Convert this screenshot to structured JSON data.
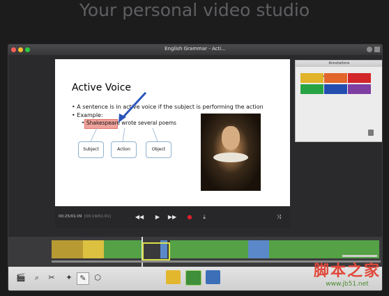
{
  "headline": "Your personal video studio",
  "window": {
    "title": "English Grammar - Acti...",
    "traffic_lights": {
      "close": "#fc5f57",
      "minimize": "#fdbc2e",
      "zoom": "#29c940"
    }
  },
  "slide": {
    "title": "Active Voice",
    "bullet1": "• A sentence is in active voice if the subject is performing the action",
    "bullet2": "• Example:",
    "sentence_subject": "Shakespeare",
    "sentence_rest": " wrote several poems",
    "sentence_bullet": "•",
    "boxes": [
      "Subject",
      "Action",
      "Object"
    ]
  },
  "controls": {
    "elapsed": "00:25/01:09",
    "selection": "[00:19/01:01]",
    "rewind": "◀◀",
    "play": "▶",
    "forward": "▶▶",
    "record": "●",
    "download": "⤓",
    "mute": "⤨"
  },
  "annotations": {
    "title": "Annotations",
    "tools": [
      "circle-icon",
      "line-icon",
      "rectangle-icon",
      "text-icon"
    ],
    "colors": [
      "#e0b32a",
      "#e2662c",
      "#d3262a",
      "#27a343",
      "#244db0",
      "#7f3ea1"
    ]
  },
  "timeline": {
    "segments": [
      {
        "color": "#b89a33"
      },
      {
        "color": "#dcc040"
      },
      {
        "color": "#55a146"
      },
      {
        "color": "#5b88c8"
      },
      {
        "color": "#55a146"
      },
      {
        "color": "#5b88c8"
      },
      {
        "color": "#55a146"
      },
      {
        "color": "#55a146"
      }
    ]
  },
  "watermark": {
    "brand": "脚本之家",
    "url": "www.jb51.net"
  }
}
